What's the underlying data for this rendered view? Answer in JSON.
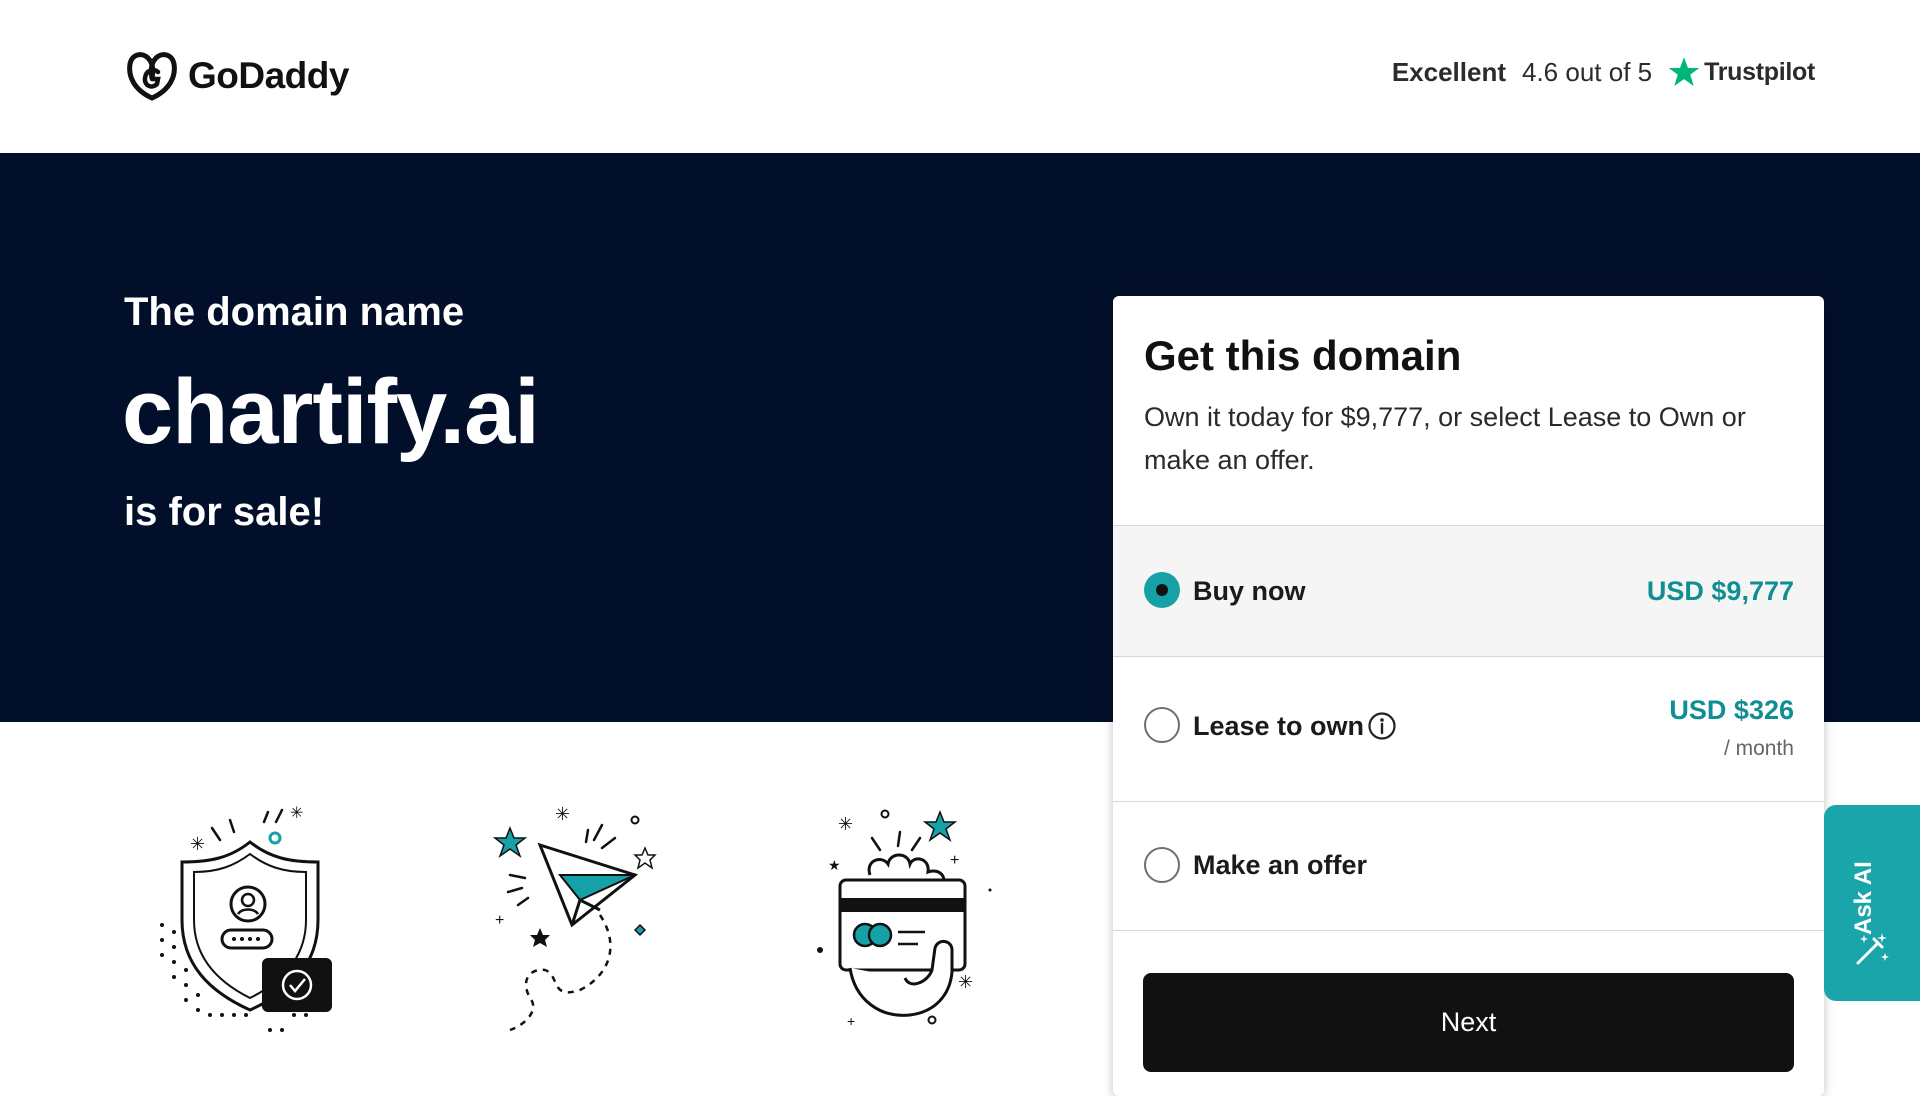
{
  "header": {
    "logo_text": "GoDaddy",
    "trust_rating_word": "Excellent",
    "trust_score": "4.6 out of 5",
    "trust_brand": "Trustpilot"
  },
  "hero": {
    "pre": "The domain name",
    "domain": "chartify.ai",
    "post": "is for sale!"
  },
  "card": {
    "title": "Get this domain",
    "subtitle": "Own it today for $9,777, or select Lease to Own or make an offer.",
    "options": [
      {
        "label": "Buy now",
        "price": "USD $9,777",
        "selected": true
      },
      {
        "label": "Lease to own",
        "price": "USD $326",
        "per": "/ month",
        "selected": false
      },
      {
        "label": "Make an offer",
        "selected": false
      }
    ],
    "next_label": "Next"
  },
  "ask_ai": {
    "label": "Ask AI"
  },
  "colors": {
    "hero_bg": "#020f2a",
    "accent_teal": "#16a1a6",
    "price_teal": "#108f93",
    "trustpilot_green": "#00b67a",
    "button_dark": "#111111"
  },
  "icons": [
    "godaddy-logo-icon",
    "trustpilot-star-icon",
    "info-icon",
    "magic-wand-icon",
    "shield-illustration-icon",
    "paper-plane-illustration-icon",
    "credit-card-illustration-icon"
  ]
}
